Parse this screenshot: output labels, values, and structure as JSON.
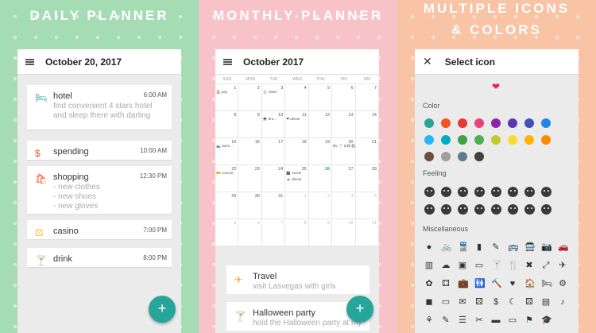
{
  "daily": {
    "headline": "DAILY PLANNER",
    "date": "October 20, 2017",
    "events": [
      {
        "icon": "bed-icon",
        "glyph": "🛏",
        "color": "#26a69a",
        "title": "hotel",
        "time": "6:00 AM",
        "note": "find convenient 4 stars hotel and sleep there with darling"
      },
      {
        "icon": "dollar-icon",
        "glyph": "$",
        "color": "#f4511e",
        "title": "spending",
        "time": "10:00 AM",
        "note": ""
      },
      {
        "icon": "shopping-bag-icon",
        "glyph": "🛍",
        "color": "#f4511e",
        "title": "shopping",
        "time": "12:30 PM",
        "note": "- new clothes\n- new shoes\n- new gloves"
      },
      {
        "icon": "dice-icon",
        "glyph": "⚄",
        "color": "#f9c74f",
        "title": "casino",
        "time": "7:00 PM",
        "note": ""
      },
      {
        "icon": "cocktail-icon",
        "glyph": "🍸",
        "color": "#8e24aa",
        "title": "drink",
        "time": "8:00 PM",
        "note": ""
      }
    ],
    "fab": "+"
  },
  "monthly": {
    "headline": "MONTHLY PLANNER",
    "month": "October 2017",
    "weekdays": [
      "SUN",
      "MON",
      "TUE",
      "WED",
      "THU",
      "FRI",
      "SAT"
    ],
    "weeks": [
      [
        {
          "d": "1",
          "ev": [
            "🏠 pay"
          ]
        },
        {
          "d": "2",
          "ev": []
        },
        {
          "d": "3",
          "ev": [
            "🎂 sister"
          ]
        },
        {
          "d": "4",
          "ev": []
        },
        {
          "d": "5",
          "ev": []
        },
        {
          "d": "6",
          "ev": []
        },
        {
          "d": "7",
          "ev": []
        }
      ],
      [
        {
          "d": "8",
          "ev": []
        },
        {
          "d": "9",
          "ev": []
        },
        {
          "d": "10",
          "ev": [
            "💻 bru..."
          ]
        },
        {
          "d": "11",
          "ev": [
            "❤ dinner"
          ]
        },
        {
          "d": "12",
          "ev": []
        },
        {
          "d": "13",
          "ev": []
        },
        {
          "d": "14",
          "ev": []
        }
      ],
      [
        {
          "d": "15",
          "ev": [
            "🏊 swim..."
          ]
        },
        {
          "d": "16",
          "ev": []
        },
        {
          "d": "17",
          "ev": []
        },
        {
          "d": "18",
          "ev": []
        },
        {
          "d": "19",
          "ev": []
        },
        {
          "d": "20",
          "ev": [
            "🛏 🍸 $ ⚄ 🛍"
          ]
        },
        {
          "d": "21",
          "ev": []
        }
      ],
      [
        {
          "d": "22",
          "ev": [
            "🎫 concert"
          ]
        },
        {
          "d": "23",
          "ev": []
        },
        {
          "d": "24",
          "ev": []
        },
        {
          "d": "25",
          "ev": [
            "🎬 movie",
            "🍝 dinner"
          ]
        },
        {
          "d": "26",
          "ev": [],
          "today": true
        },
        {
          "d": "27",
          "ev": []
        },
        {
          "d": "28",
          "ev": []
        }
      ],
      [
        {
          "d": "29",
          "ev": []
        },
        {
          "d": "30",
          "ev": []
        },
        {
          "d": "31",
          "ev": []
        },
        {
          "d": "1",
          "ev": [],
          "grey": true
        },
        {
          "d": "2",
          "ev": [],
          "grey": true
        },
        {
          "d": "3",
          "ev": [],
          "grey": true
        },
        {
          "d": "4",
          "ev": [],
          "grey": true
        }
      ],
      [
        {
          "d": "5",
          "ev": [],
          "grey": true
        },
        {
          "d": "6",
          "ev": [],
          "grey": true
        },
        {
          "d": "7",
          "ev": [],
          "grey": true
        },
        {
          "d": "8",
          "ev": [],
          "grey": true
        },
        {
          "d": "9",
          "ev": [],
          "grey": true
        },
        {
          "d": "10",
          "ev": [],
          "grey": true
        },
        {
          "d": "11",
          "ev": [],
          "grey": true
        }
      ]
    ],
    "tasks": [
      {
        "icon": "airplane-icon",
        "glyph": "✈",
        "color": "#f9a825",
        "title": "Travel",
        "note": "visit Lasvegas with girls"
      },
      {
        "icon": "cocktail-icon",
        "glyph": "🍸",
        "color": "#f4511e",
        "title": "Halloween party",
        "note": "hold the Halloween party at my"
      }
    ],
    "fab": "+"
  },
  "icons": {
    "headline1": "MULTIPLE ICONS",
    "headline2": "& COLORS",
    "title": "Select icon",
    "selected": "❤",
    "selected_color": "#e91e63",
    "color_label": "Color",
    "colors": [
      "#26a69a",
      "#f4511e",
      "#e53935",
      "#ec407a",
      "#8e24aa",
      "#5e35b1",
      "#3f51b5",
      "#1e88e5",
      "#29b6f6",
      "#00acc1",
      "#43a047",
      "#4caf50",
      "#c0ca33",
      "#fdd835",
      "#ffb300",
      "#fb8c00",
      "#6d4c41",
      "#9e9e9e",
      "#607d8b",
      "#424242"
    ],
    "feeling_label": "Feeling",
    "faces": 16,
    "misc_label": "Miscellaneous",
    "misc": [
      "●",
      "🚲",
      "🚆",
      "▮",
      "✎",
      "🚌",
      "🚍",
      "📷",
      "🚗",
      "▥",
      "☁",
      "▣",
      "▭",
      "🍸",
      "🍴",
      "✖",
      "⤢",
      "✈",
      "✿",
      "⚃",
      "💼",
      "🚻",
      "🔨",
      "♥",
      "🏠",
      "🛏",
      "⚙",
      "◼",
      "▭",
      "✉",
      "⚄",
      "$",
      "☾",
      "⚄",
      "▤",
      "♪",
      "⚘",
      "✎",
      "☰",
      "✂",
      "▬",
      "▭",
      "⚑",
      "🎓"
    ]
  }
}
